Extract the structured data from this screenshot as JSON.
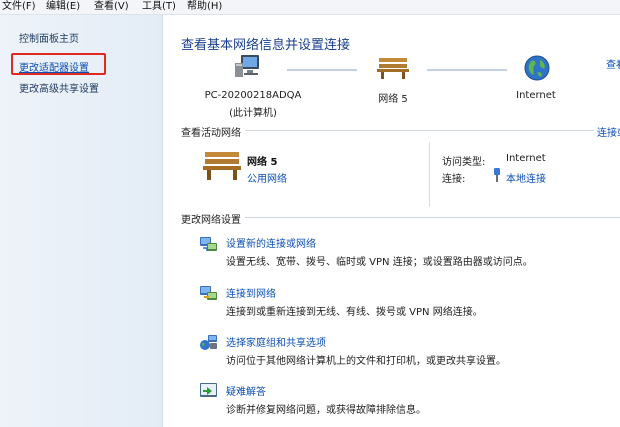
{
  "menubar": {
    "items": [
      "文件(F)",
      "编辑(E)",
      "查看(V)",
      "工具(T)",
      "帮助(H)"
    ]
  },
  "sidebar": {
    "home": "控制面板主页",
    "adapter": "更改适配器设置",
    "advanced_sharing": "更改高级共享设置"
  },
  "main": {
    "title": "查看基本网络信息并设置连接",
    "see_full_map": "查看",
    "network_map": {
      "computer_name": "PC-20200218ADQA",
      "computer_sub": "(此计算机)",
      "network": "网络  5",
      "internet": "Internet"
    },
    "active_section": {
      "title": "查看活动网络",
      "connect_disconnect": "连接或",
      "network_name": "网络  5",
      "network_type": "公用网络",
      "access_type_label": "访问类型:",
      "access_type_value": "Internet",
      "connection_label": "连接:",
      "connection_value": "本地连接"
    },
    "change_section": {
      "title": "更改网络设置",
      "tasks": [
        {
          "link": "设置新的连接或网络",
          "desc": "设置无线、宽带、拨号、临时或 VPN 连接；或设置路由器或访问点。",
          "icon": "new-connection-icon"
        },
        {
          "link": "连接到网络",
          "desc": "连接到或重新连接到无线、有线、拨号或 VPN 网络连接。",
          "icon": "connect-network-icon"
        },
        {
          "link": "选择家庭组和共享选项",
          "desc": "访问位于其他网络计算机上的文件和打印机，或更改共享设置。",
          "icon": "homegroup-icon"
        },
        {
          "link": "疑难解答",
          "desc": "诊断并修复网络问题，或获得故障排除信息。",
          "icon": "troubleshoot-icon"
        }
      ]
    }
  },
  "colors": {
    "link": "#0b4fb4",
    "title": "#1a3f8f",
    "highlight_box": "#e02a20",
    "sidebar_bg": "#e8eff8"
  }
}
